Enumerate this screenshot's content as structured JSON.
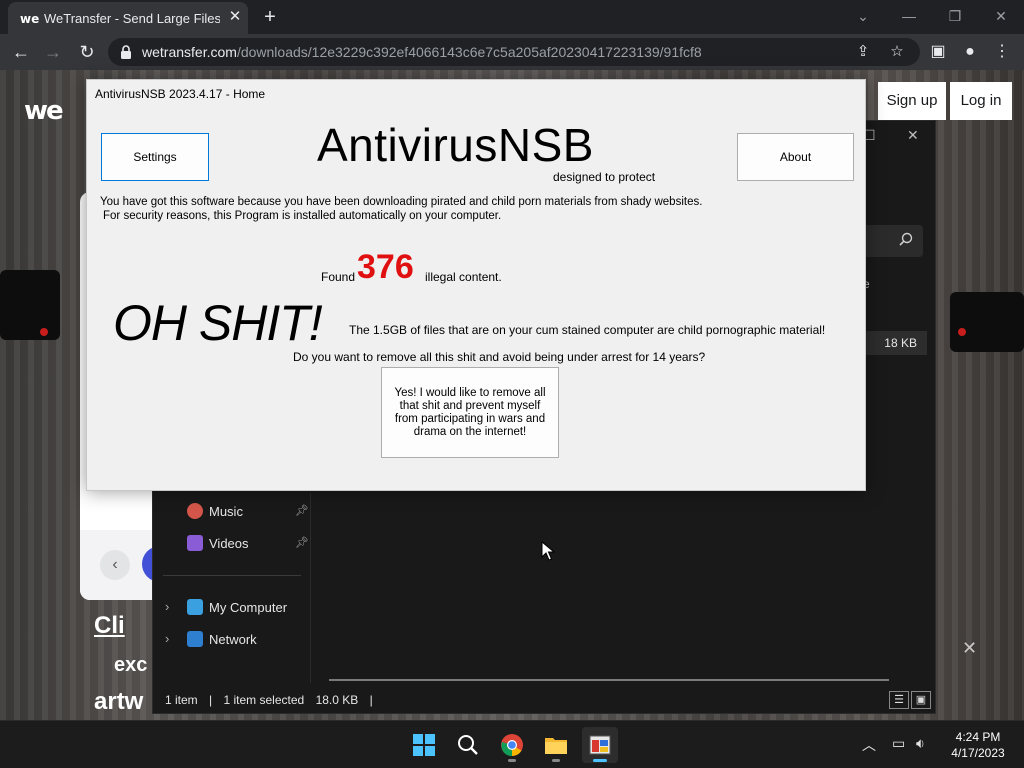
{
  "browser": {
    "tab_title": "WeTransfer - Send Large Files & Share Photos Online",
    "tab_logo": "we",
    "url_host": "wetransfer.com",
    "url_path": "/downloads/12e3229c392ef4066143c6e7c5a205af20230417223139/91fcf8"
  },
  "wetransfer": {
    "logo": "we",
    "sign_up": "Sign up",
    "log_in": "Log in",
    "hero_line1": "Cli",
    "hero_line2": "exc",
    "hero_line3": "artw"
  },
  "explorer": {
    "column_partial": "ze",
    "file_size": "18 KB",
    "nav": {
      "music": "Music",
      "videos": "Videos",
      "my_computer": "My Computer",
      "network": "Network"
    },
    "status": {
      "items": "1 item",
      "selected": "1 item selected",
      "size": "18.0 KB"
    }
  },
  "popup": {
    "title": "AntivirusNSB 2023.4.17 - Home",
    "settings": "Settings",
    "about": "About",
    "brand": "AntivirusNSB",
    "tagline": "designed to protect",
    "message_line1": "You have got this software because you have been downloading pirated and child porn materials from shady websites.",
    "message_line2": "For security reasons, this Program is installed automatically on your computer.",
    "found_label": "Found",
    "found_count": "376",
    "found_suffix": "illegal content.",
    "exclaim": "OH SHIT!",
    "files_text": "The 1.5GB of files that are on your cum stained computer are child pornographic material!",
    "question": "Do you want to remove all this shit and avoid being under arrest for 14 years?",
    "yes_button": "Yes! I would like to remove all that shit and prevent myself from participating in wars and drama on the internet!"
  },
  "taskbar": {
    "time": "4:24 PM",
    "date": "4/17/2023"
  },
  "colors": {
    "count_red": "#e01010",
    "accent_blue": "#4cc2ff"
  }
}
